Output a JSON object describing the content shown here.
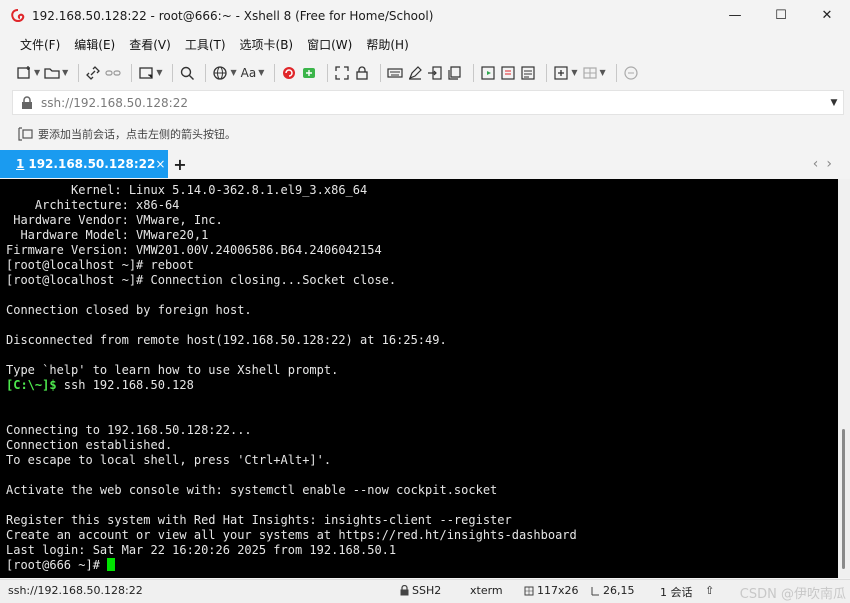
{
  "window": {
    "title": "192.168.50.128:22 - root@666:~ - Xshell 8 (Free for Home/School)",
    "minimize": "—",
    "maximize": "☐",
    "close": "✕"
  },
  "menu": [
    "文件(F)",
    "编辑(E)",
    "查看(V)",
    "工具(T)",
    "选项卡(B)",
    "窗口(W)",
    "帮助(H)"
  ],
  "toolbar": {
    "font_label": "Aa"
  },
  "address": {
    "value": "ssh://192.168.50.128:22"
  },
  "hint": {
    "text": "要添加当前会话，点击左侧的箭头按钮。"
  },
  "tab": {
    "number": "1",
    "label": "192.168.50.128:22",
    "close": "×",
    "add": "+",
    "nav_prev": "‹",
    "nav_next": "›",
    "status_color": "#23c33a",
    "accent": "#1a9bf0"
  },
  "terminal": {
    "lines": [
      "         Kernel: Linux 5.14.0-362.8.1.el9_3.x86_64",
      "    Architecture: x86-64",
      " Hardware Vendor: VMware, Inc.",
      "  Hardware Model: VMware20,1",
      "Firmware Version: VMW201.00V.24006586.B64.2406042154",
      "[root@localhost ~]# reboot",
      "[root@localhost ~]# Connection closing...Socket close.",
      "",
      "Connection closed by foreign host.",
      "",
      "Disconnected from remote host(192.168.50.128:22) at 16:25:49.",
      "",
      "Type `help' to learn how to use Xshell prompt."
    ],
    "local_prompt": "[C:\\~]$",
    "local_command": " ssh 192.168.50.128",
    "lines_after": [
      "",
      "",
      "Connecting to 192.168.50.128:22...",
      "Connection established.",
      "To escape to local shell, press 'Ctrl+Alt+]'.",
      "",
      "Activate the web console with: systemctl enable --now cockpit.socket",
      "",
      "Register this system with Red Hat Insights: insights-client --register",
      "Create an account or view all your systems at https://red.ht/insights-dashboard",
      "Last login: Sat Mar 22 16:20:26 2025 from 192.168.50.1"
    ],
    "final_prompt": "[root@666 ~]# "
  },
  "status": {
    "address": "ssh://192.168.50.128:22",
    "protocol": "SSH2",
    "terminal_type": "xterm",
    "size": "117x26",
    "position": "26,15",
    "sessions": "1 会话",
    "up": "⇧",
    "watermark": "CSDN @伊吹南瓜"
  }
}
